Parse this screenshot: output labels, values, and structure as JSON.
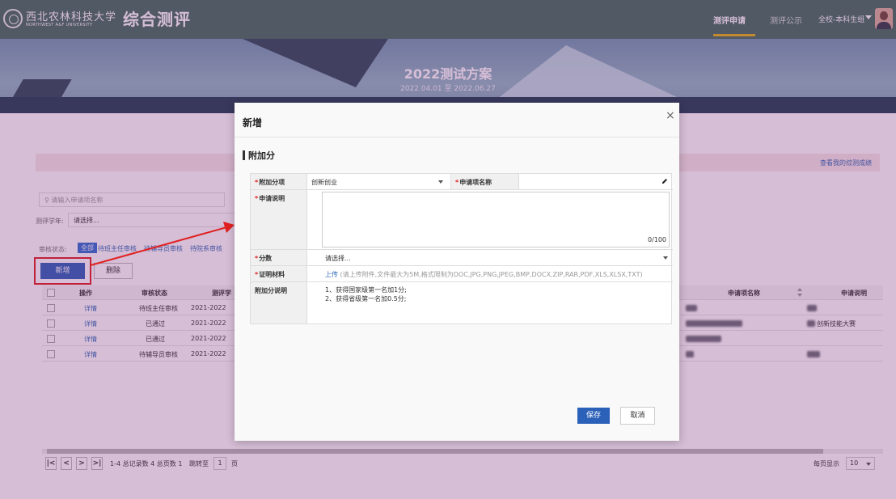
{
  "header": {
    "university_cn": "西北农林科技大学",
    "university_en": "NORTHWEST A&F UNIVERSITY",
    "system_title": "综合测评",
    "nav": [
      {
        "label": "测评申请",
        "active": true
      },
      {
        "label": "测评公示",
        "active": false
      }
    ],
    "user_menu": "全校-本科生组"
  },
  "banner": {
    "title": "2022测试方案",
    "date_range": "2022.04.01 至 2022.06.27"
  },
  "page": {
    "rules_link": "查看我的综测成绩",
    "search_placeholder": "请输入申请项名称",
    "year_label": "测评学年:",
    "year_value": "请选择...",
    "status_label": "审核状态:",
    "status_chips": [
      "全部",
      "待班主任审核",
      "待辅导员审核",
      "待院系审核"
    ],
    "add_button": "新增",
    "delete_button": "删除",
    "table": {
      "headers": [
        "操作",
        "审核状态",
        "测评学",
        "申请项名称",
        "申请说明"
      ],
      "rows": [
        {
          "action": "详情",
          "status": "待班主任审核",
          "year": "2021-2022",
          "note": ""
        },
        {
          "action": "详情",
          "status": "已通过",
          "year": "2021-2022",
          "note": "创新技能大赛"
        },
        {
          "action": "详情",
          "status": "已通过",
          "year": "2021-2022",
          "note": ""
        },
        {
          "action": "详情",
          "status": "待辅导员审核",
          "year": "2021-2022",
          "note": ""
        }
      ]
    },
    "pager": {
      "first": "|<",
      "prev": "<",
      "next": ">",
      "last": ">|",
      "summary": "1-4 总记录数 4   总页数 1",
      "jump_label": "跳转至",
      "jump_value": "1",
      "page_unit": "页",
      "page_size_label": "每页显示",
      "page_size": "10"
    }
  },
  "modal": {
    "title": "新增",
    "close": "×",
    "section_title": "附加分",
    "fields": {
      "category_label": "附加分项",
      "category_value": "创新创业",
      "item_name_label": "申请项名称",
      "item_name_value": "",
      "description_label": "申请说明",
      "description_counter": "0/100",
      "score_label": "分数",
      "score_value": "请选择...",
      "evidence_label": "证明材料",
      "upload_link": "上传",
      "upload_hint": "(请上传附件,文件最大为5M,格式限制为DOC,JPG,PNG,JPEG,BMP,DOCX,ZIP,RAR,PDF,XLS,XLSX,TXT)",
      "bonus_label": "附加分说明",
      "bonus_notes": [
        "1、获得国家级第一名加1分;",
        "2、获得省级第一名加0.5分;"
      ]
    },
    "save_button": "保存",
    "cancel_button": "取消"
  },
  "colors": {
    "header_bg": "#3f6f5c",
    "primary_button": "#2c61b9",
    "link": "#2f69b3",
    "required": "#e02020",
    "highlight": "#e02020",
    "overlay": "rgba(120,40,120,0.30)"
  }
}
